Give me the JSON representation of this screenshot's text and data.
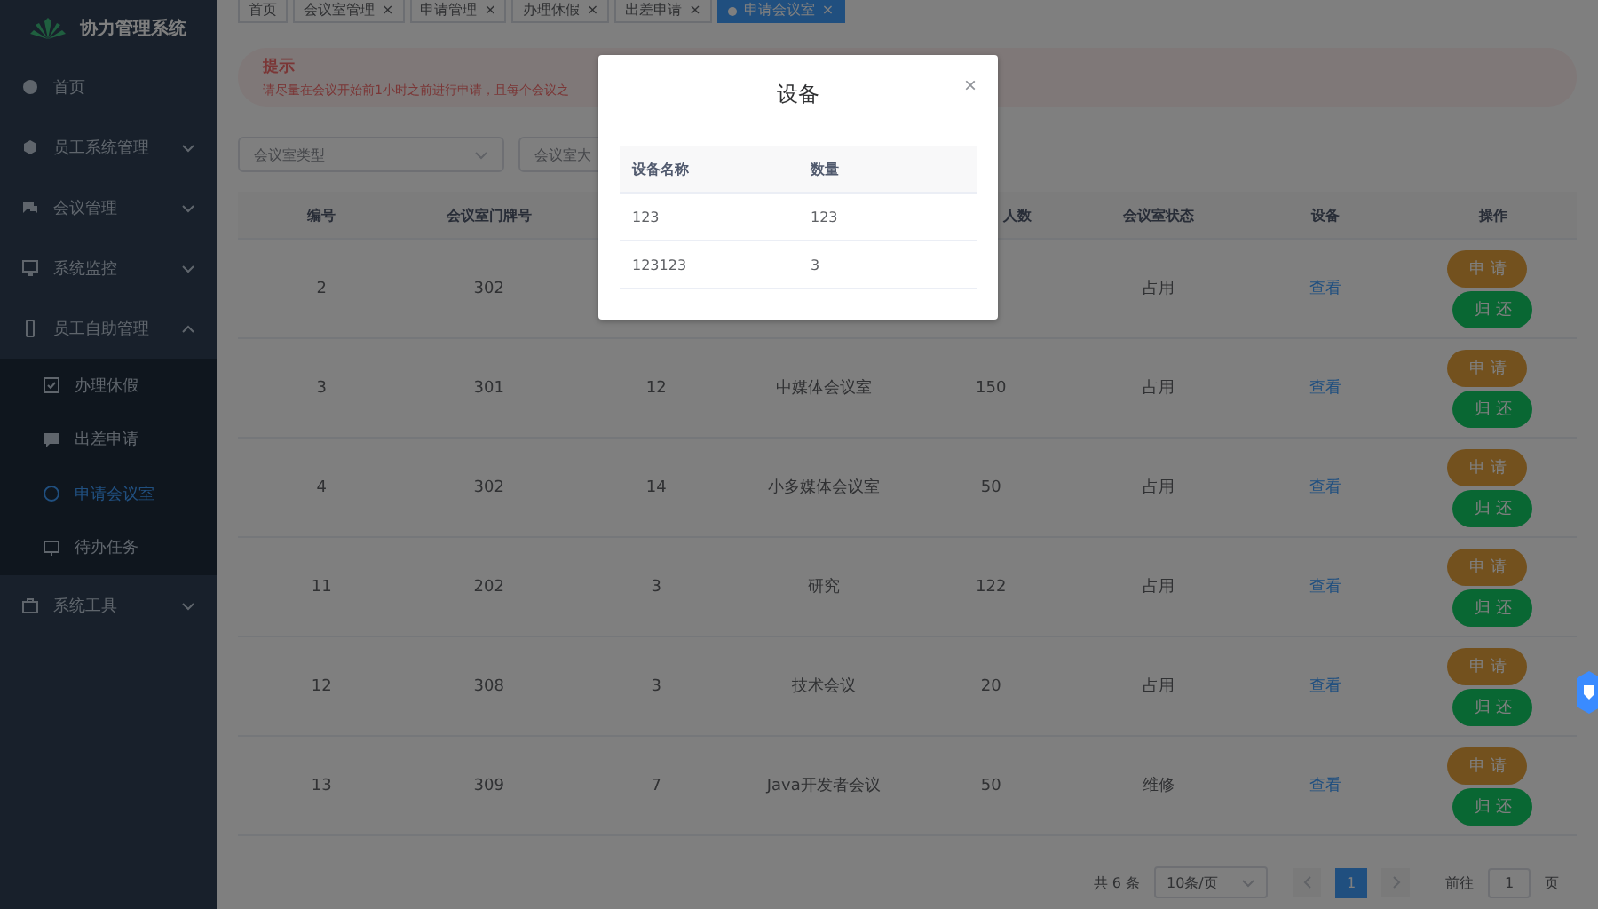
{
  "sidebar": {
    "logo_text": "协力管理系统",
    "items": [
      {
        "label": "首页"
      },
      {
        "label": "员工系统管理",
        "expanded": false,
        "has_children": true
      },
      {
        "label": "会议管理",
        "expanded": false,
        "has_children": true
      },
      {
        "label": "系统监控",
        "expanded": false,
        "has_children": true
      },
      {
        "label": "员工自助管理",
        "expanded": true,
        "has_children": true,
        "children": [
          {
            "label": "办理休假",
            "selected": false
          },
          {
            "label": "出差申请",
            "selected": false
          },
          {
            "label": "申请会议室",
            "selected": true
          },
          {
            "label": "待办任务",
            "selected": false
          }
        ]
      },
      {
        "label": "系统工具",
        "expanded": false,
        "has_children": true
      }
    ]
  },
  "tabs": [
    {
      "label": "首页",
      "closable": false,
      "selected": false
    },
    {
      "label": "会议室管理",
      "closable": true,
      "selected": false
    },
    {
      "label": "申请管理",
      "closable": true,
      "selected": false
    },
    {
      "label": "办理休假",
      "closable": true,
      "selected": false
    },
    {
      "label": "出差申请",
      "closable": true,
      "selected": false
    },
    {
      "label": "申请会议室",
      "closable": true,
      "selected": true
    }
  ],
  "tab_close": "×",
  "alert": {
    "title": "提示",
    "text": "请尽量在会议开始前1小时之前进行申请，且每个会议之"
  },
  "filters": [
    {
      "placeholder": "会议室类型"
    },
    {
      "placeholder": "会议室大"
    }
  ],
  "table": {
    "columns": [
      "编号",
      "会议室门牌号",
      "",
      "",
      "人数",
      "会议室状态",
      "设备",
      "操作"
    ],
    "rows": [
      {
        "cells": [
          "2",
          "302",
          "",
          "",
          "",
          "占用"
        ],
        "link": "查看",
        "actions": [
          "申 请",
          "归 还"
        ]
      },
      {
        "cells": [
          "3",
          "301",
          "12",
          "中媒体会议室",
          "150",
          "占用"
        ],
        "link": "查看",
        "actions": [
          "申 请",
          "归 还"
        ]
      },
      {
        "cells": [
          "4",
          "302",
          "14",
          "小多媒体会议室",
          "50",
          "占用"
        ],
        "link": "查看",
        "actions": [
          "申 请",
          "归 还"
        ]
      },
      {
        "cells": [
          "11",
          "202",
          "3",
          "研究",
          "122",
          "占用"
        ],
        "link": "查看",
        "actions": [
          "申 请",
          "归 还"
        ]
      },
      {
        "cells": [
          "12",
          "308",
          "3",
          "技术会议",
          "20",
          "占用"
        ],
        "link": "查看",
        "actions": [
          "申 请",
          "归 还"
        ]
      },
      {
        "cells": [
          "13",
          "309",
          "7",
          "Java开发者会议",
          "50",
          "维修"
        ],
        "link": "查看",
        "actions": [
          "申 请",
          "归 还"
        ]
      }
    ]
  },
  "pagination": {
    "total": "共 6 条",
    "page_size": "10条/页",
    "pages": [
      {
        "label": "1",
        "selected": true
      }
    ],
    "jump_label": "前往",
    "jump_value": "1",
    "jump_suffix": "页"
  },
  "dialog": {
    "title": "设备",
    "close": "×",
    "columns": [
      "设备名称",
      "数量"
    ],
    "rows": [
      [
        "123",
        "123"
      ],
      [
        "123123",
        "3"
      ]
    ]
  }
}
